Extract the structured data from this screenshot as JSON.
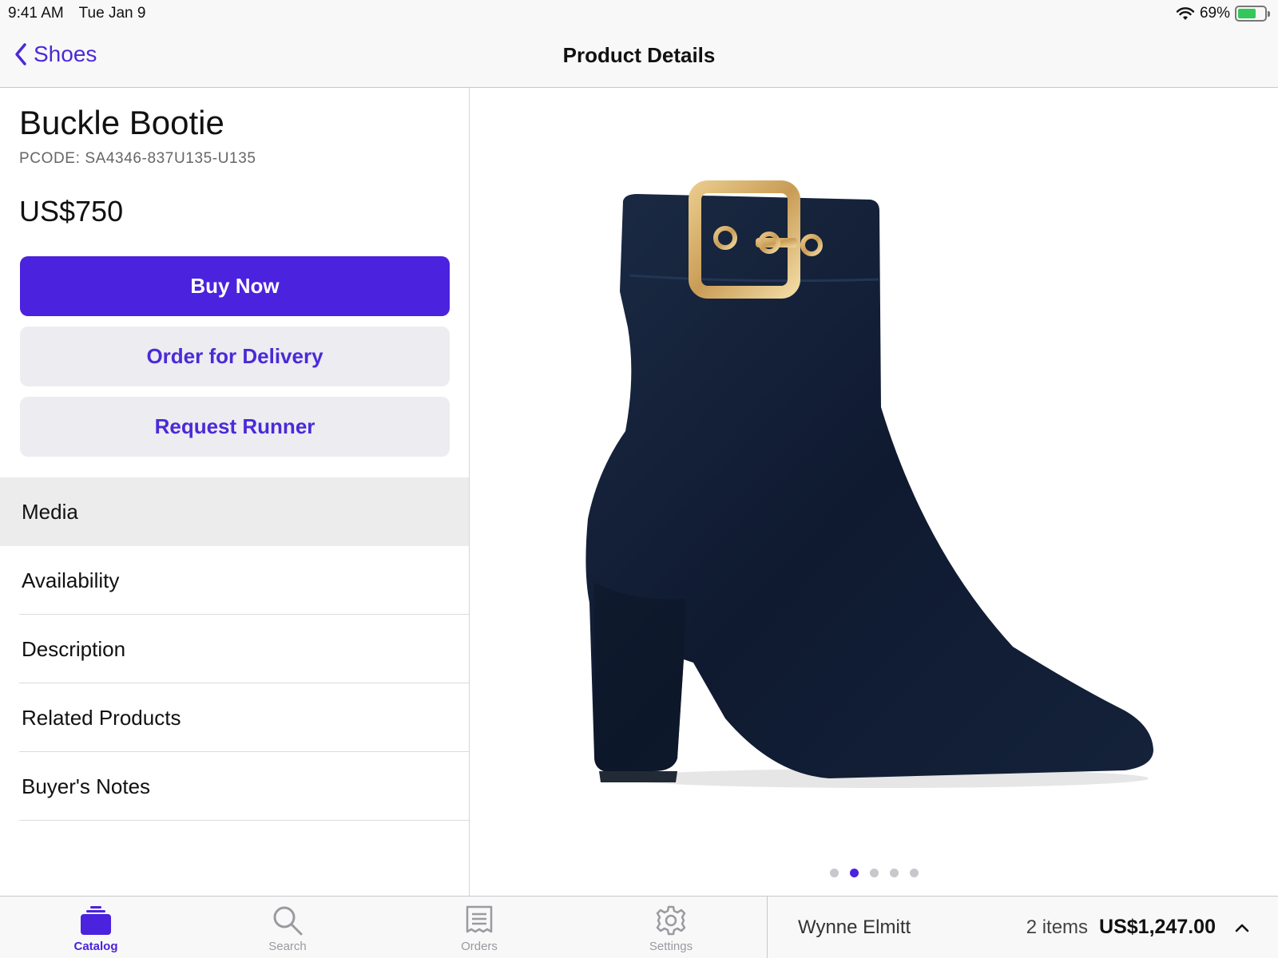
{
  "status": {
    "time": "9:41 AM",
    "date": "Tue Jan 9",
    "battery": "69%",
    "battery_level": 0.69
  },
  "nav": {
    "back_label": "Shoes",
    "title": "Product Details"
  },
  "product": {
    "name": "Buckle Bootie",
    "pcode": "PCODE: SA4346-837U135-U135",
    "price": "US$750"
  },
  "actions": {
    "buy_now": "Buy Now",
    "order_delivery": "Order for Delivery",
    "request_runner": "Request Runner"
  },
  "menu": {
    "items": [
      {
        "label": "Media",
        "selected": true
      },
      {
        "label": "Availability",
        "selected": false
      },
      {
        "label": "Description",
        "selected": false
      },
      {
        "label": "Related Products",
        "selected": false
      },
      {
        "label": "Buyer's Notes",
        "selected": false
      }
    ]
  },
  "gallery": {
    "page_count": 5,
    "active_page": 2
  },
  "tabs": [
    {
      "label": "Catalog",
      "icon": "catalog-icon",
      "active": true
    },
    {
      "label": "Search",
      "icon": "search-icon",
      "active": false
    },
    {
      "label": "Orders",
      "icon": "orders-icon",
      "active": false
    },
    {
      "label": "Settings",
      "icon": "settings-icon",
      "active": false
    }
  ],
  "cart": {
    "customer": "Wynne Elmitt",
    "items": "2 items",
    "total": "US$1,247.00"
  },
  "colors": {
    "accent": "#4b22dd",
    "accent_text": "#4b2ad8",
    "secondary_button": "#ececf1",
    "selected_row": "#ececec",
    "battery_green": "#34c759"
  }
}
